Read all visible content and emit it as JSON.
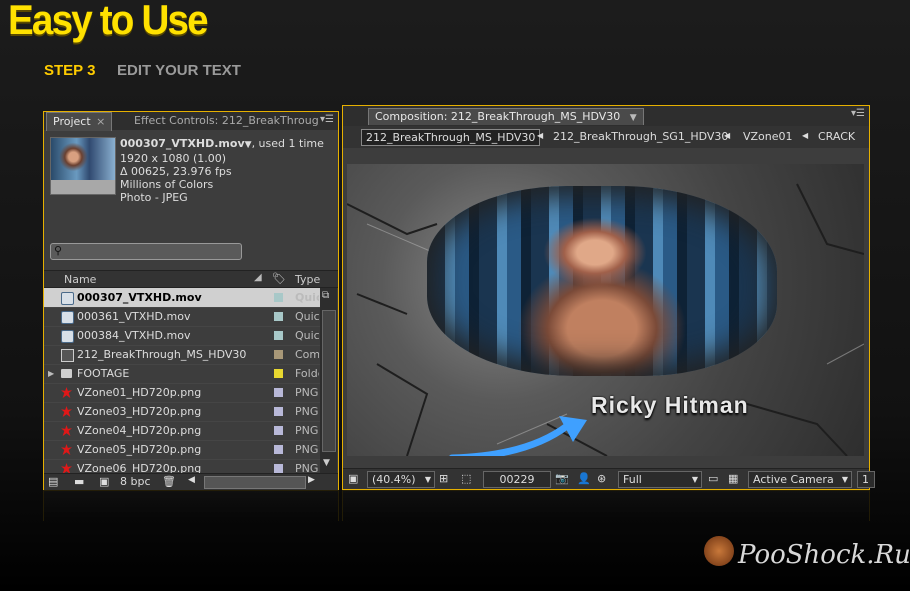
{
  "header": {
    "title": "Easy to Use",
    "step_label": "STEP 3",
    "step_name": "EDIT YOUR TEXT"
  },
  "project_panel": {
    "tabs": [
      {
        "label": "Project"
      },
      {
        "label": "Effect Controls: 212_BreakThroug"
      }
    ],
    "preview": {
      "name": "000307_VTXHD.mov",
      "used": ", used 1 time",
      "lines": [
        "1920 x 1080 (1.00)",
        "Δ 00625, 23.976 fps",
        "Millions of Colors",
        "Photo - JPEG"
      ]
    },
    "search_placeholder": "",
    "columns": {
      "name": "Name",
      "type": "Type"
    },
    "items": [
      {
        "name": "000307_VTXHD.mov",
        "type": "Quick",
        "icon": "quicktime-icon",
        "swatch": "#a8c8c8",
        "selected": true
      },
      {
        "name": "000361_VTXHD.mov",
        "type": "Quick",
        "icon": "quicktime-icon",
        "swatch": "#a8c8c8"
      },
      {
        "name": "000384_VTXHD.mov",
        "type": "Quick",
        "icon": "quicktime-icon",
        "swatch": "#a8c8c8"
      },
      {
        "name": "212_BreakThrough_MS_HDV30",
        "type": "Comp",
        "icon": "composition-icon",
        "swatch": "#a89878"
      },
      {
        "name": "FOOTAGE",
        "type": "Folde",
        "icon": "folder-icon",
        "swatch": "#e8d830"
      },
      {
        "name": "VZone01_HD720p.png",
        "type": "PNG I",
        "icon": "png-icon",
        "swatch": "#b8b8d8"
      },
      {
        "name": "VZone03_HD720p.png",
        "type": "PNG I",
        "icon": "png-icon",
        "swatch": "#b8b8d8"
      },
      {
        "name": "VZone04_HD720p.png",
        "type": "PNG I",
        "icon": "png-icon",
        "swatch": "#b8b8d8"
      },
      {
        "name": "VZone05_HD720p.png",
        "type": "PNG I",
        "icon": "png-icon",
        "swatch": "#b8b8d8"
      },
      {
        "name": "VZone06_HD720p.png",
        "type": "PNG I",
        "icon": "png-icon",
        "swatch": "#b8b8d8"
      }
    ],
    "footer": {
      "bpc": "8 bpc"
    }
  },
  "composition_panel": {
    "tab_label": "Composition: 212_BreakThrough_MS_HDV30",
    "breadcrumbs": [
      "212_BreakThrough_MS_HDV30",
      "212_BreakThrough_SG1_HDV30",
      "VZone01",
      "CRACK"
    ],
    "overlay_text": "Ricky Hitman",
    "toolbar": {
      "zoom": "(40.4%)",
      "frame": "00229",
      "resolution": "Full",
      "camera": "Active Camera",
      "views": "1"
    }
  },
  "watermark": "PooShock.Ru",
  "colors": {
    "accent": "#ffe100",
    "highlight_border": "#e6b000"
  }
}
